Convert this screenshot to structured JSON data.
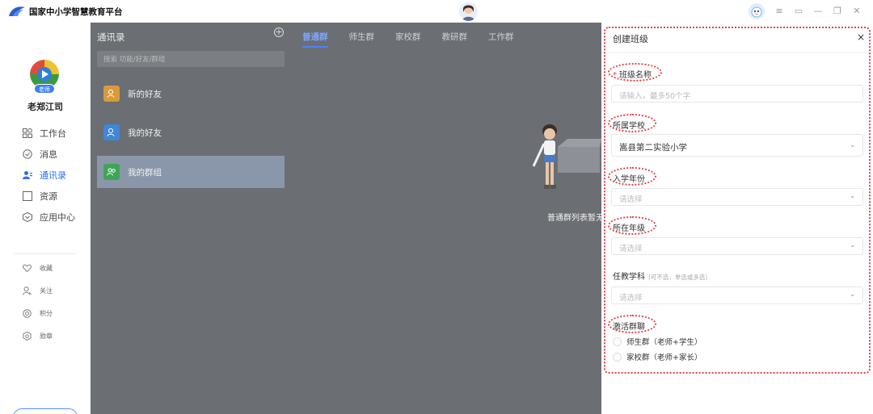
{
  "app": {
    "title": "国家中小学智慧教育平台"
  },
  "window_controls": [
    "menu-icon",
    "screen-icon",
    "minimize-icon",
    "maximize-icon",
    "close-icon"
  ],
  "user": {
    "name": "老郑江司",
    "role": "老师"
  },
  "nav": {
    "primary": [
      {
        "label": "工作台",
        "icon": "grid-icon"
      },
      {
        "label": "消息",
        "icon": "chat-icon"
      },
      {
        "label": "通讯录",
        "icon": "contacts-icon",
        "active": true
      },
      {
        "label": "资源",
        "icon": "folder-icon"
      },
      {
        "label": "应用中心",
        "icon": "apps-icon"
      }
    ],
    "secondary": [
      {
        "label": "收藏",
        "icon": "heart-icon"
      },
      {
        "label": "关注",
        "icon": "person-icon"
      },
      {
        "label": "积分",
        "icon": "points-icon"
      },
      {
        "label": "勋章",
        "icon": "medal-icon"
      }
    ]
  },
  "contacts": {
    "title": "通讯录",
    "search_placeholder": "搜索 功能/好友/群组",
    "items": [
      {
        "label": "新的好友",
        "color": "#e7a23a"
      },
      {
        "label": "我的好友",
        "color": "#3d8fe6"
      },
      {
        "label": "我的群组",
        "color": "#3fae5a",
        "selected": true
      }
    ]
  },
  "tabs": [
    {
      "label": "普通群",
      "active": true
    },
    {
      "label": "师生群"
    },
    {
      "label": "家校群"
    },
    {
      "label": "教研群"
    },
    {
      "label": "工作群"
    }
  ],
  "empty_state": {
    "text": "普通群列表暂无"
  },
  "dialog": {
    "title": "创建班级",
    "close": "×",
    "class_name": {
      "label": "班级名称",
      "placeholder": "请输入，最多50个字",
      "required": true
    },
    "school": {
      "label": "所属学校",
      "value": "嵩县第二实验小学"
    },
    "enroll_year": {
      "label": "入学年份",
      "placeholder": "请选择"
    },
    "grade": {
      "label": "所在年级",
      "placeholder": "请选择"
    },
    "subject": {
      "label": "任教学科",
      "hint": "(可不选，单选或多选)",
      "placeholder": "请选择"
    },
    "activate_group": {
      "label": "激活群聊",
      "options": [
        "师生群（老师+学生）",
        "家校群（老师+家长）"
      ]
    }
  },
  "colors": {
    "accent": "#2d6ff0",
    "annotation": "#e0404a",
    "overlay": "#6b6e72"
  }
}
